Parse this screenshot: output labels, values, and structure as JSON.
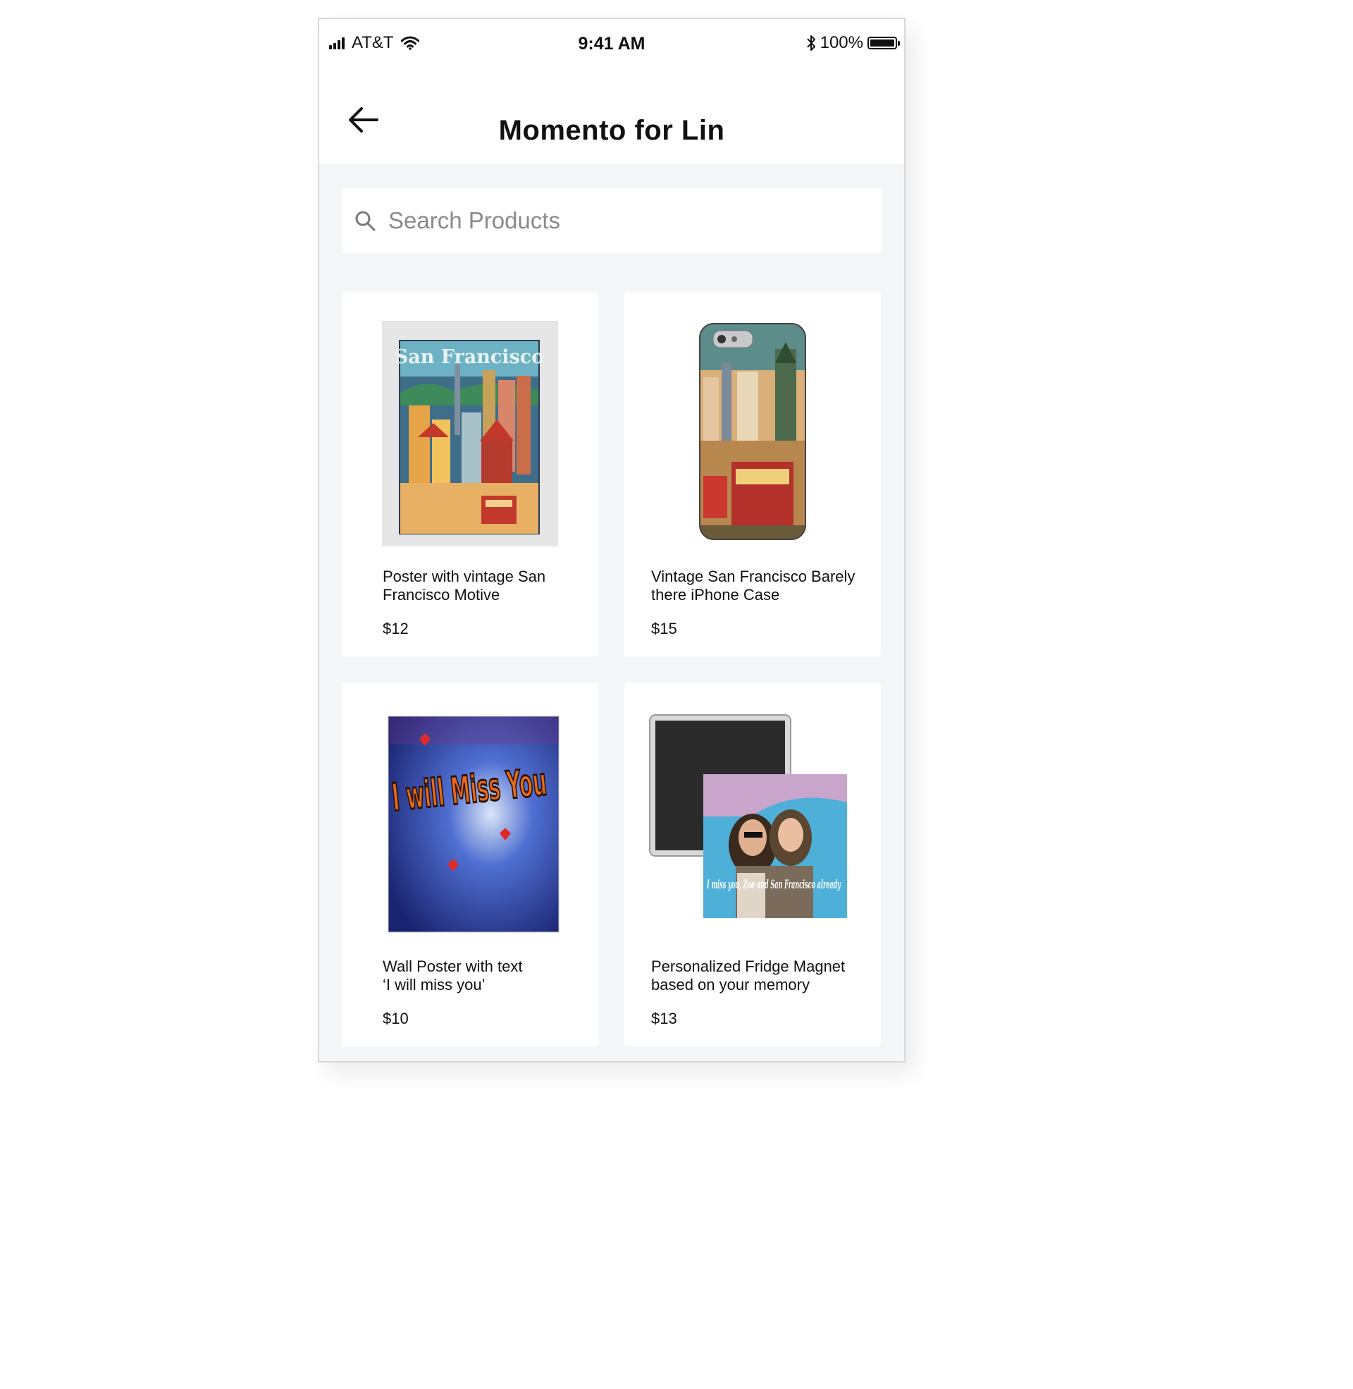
{
  "status_bar": {
    "carrier": "AT&T",
    "time": "9:41 AM",
    "battery": "100%"
  },
  "header": {
    "title": "Momento for Lin"
  },
  "search": {
    "placeholder": "Search Products"
  },
  "products": [
    {
      "name": "Poster with vintage San\nFrancisco Motive",
      "price": "$12",
      "image_text": "San Francisco"
    },
    {
      "name": "Vintage San Francisco Barely\nthere iPhone Case",
      "price": "$15"
    },
    {
      "name": "Wall Poster with text\n‘I will miss you’",
      "price": "$10",
      "image_text": "I will Miss You"
    },
    {
      "name": "Personalized Fridge Magnet\nbased on your memory",
      "price": "$13",
      "image_text": "I miss you, Zoe and San Francisco already"
    }
  ]
}
